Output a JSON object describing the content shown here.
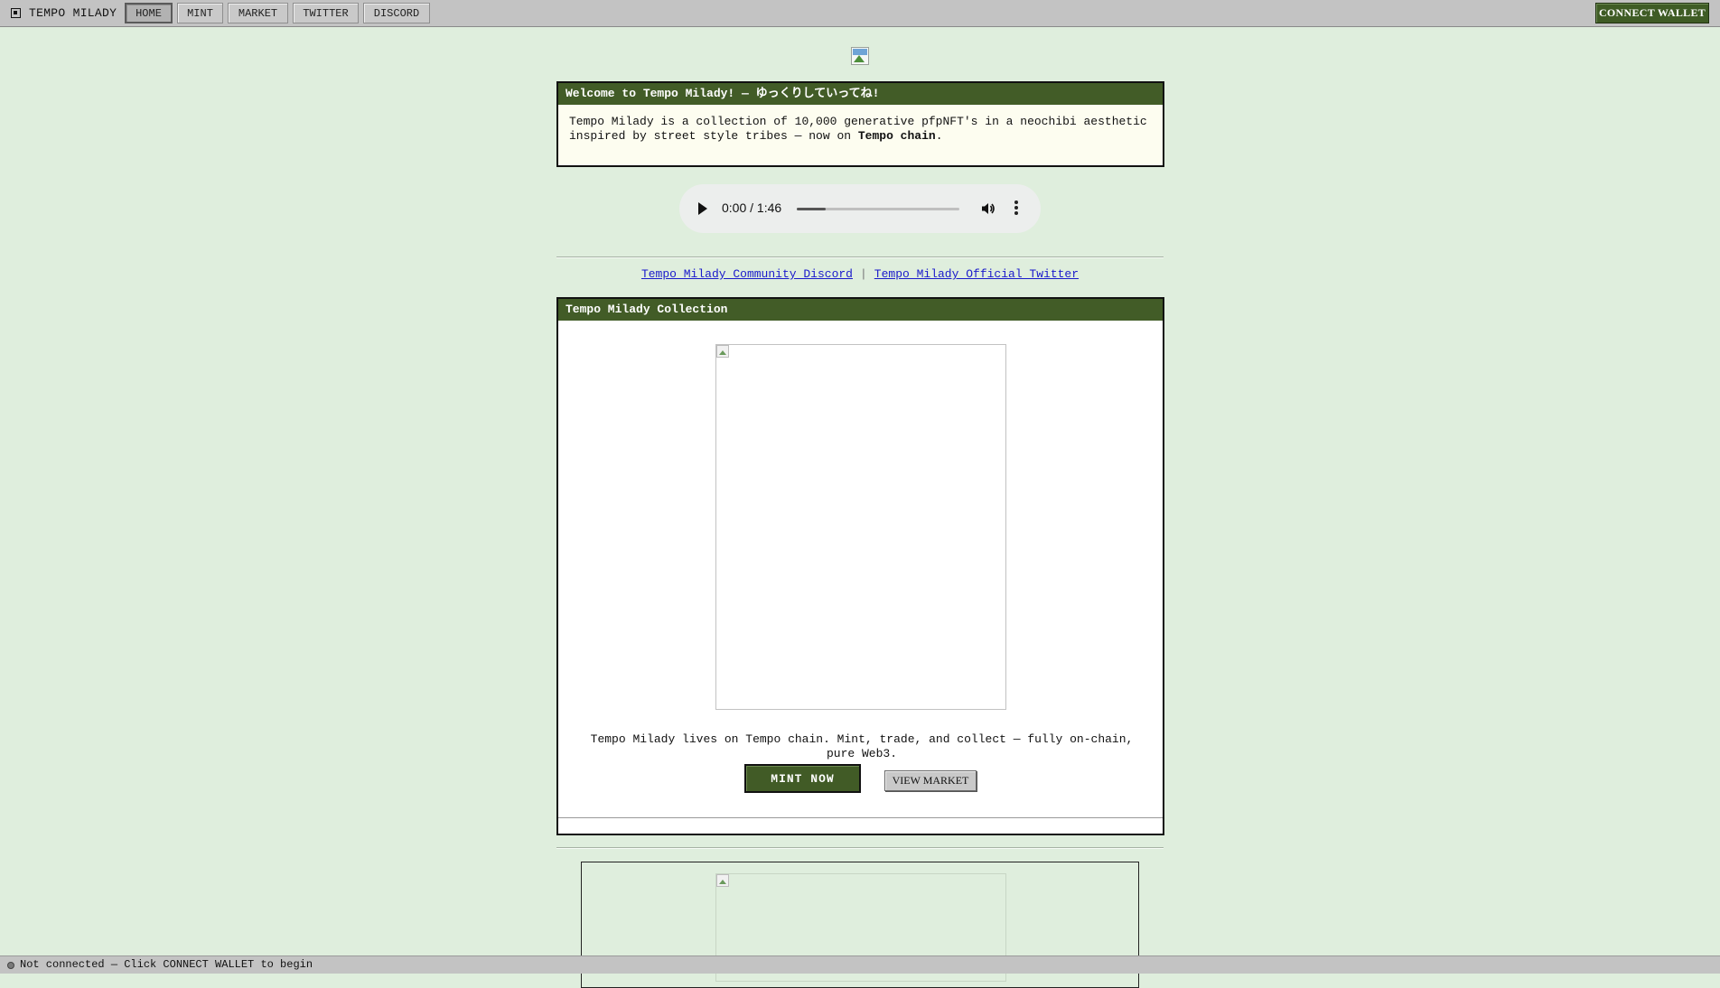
{
  "app": {
    "brand": "TEMPO MILADY",
    "nav": [
      {
        "label": "HOME",
        "active": true
      },
      {
        "label": "MINT",
        "active": false
      },
      {
        "label": "MARKET",
        "active": false
      },
      {
        "label": "TWITTER",
        "active": false
      },
      {
        "label": "DISCORD",
        "active": false
      }
    ],
    "connect_label": "CONNECT WALLET"
  },
  "welcome": {
    "title": "Welcome to Tempo Milady! — ゆっくりしていってね!",
    "body_pre": "Tempo Milady is a collection of 10,000 generative pfpNFT's in a neochibi aesthetic inspired by street style tribes — now on ",
    "body_bold": "Tempo chain",
    "body_post": "."
  },
  "audio": {
    "time": "0:00 / 1:46",
    "buffered_fraction": 0.18
  },
  "links": {
    "discord": "Tempo Milady Community Discord",
    "separator": "|",
    "twitter": "Tempo Milady Official Twitter"
  },
  "collection": {
    "title": "Tempo Milady Collection",
    "description": "Tempo Milady lives on Tempo chain. Mint, trade, and collect — fully on-chain, pure Web3.",
    "mint_label": "MINT NOW",
    "market_label": "VIEW MARKET"
  },
  "status": {
    "text": "Not connected — Click CONNECT WALLET to begin"
  },
  "colors": {
    "page_bg": "#dfeedd",
    "accent": "#425c27",
    "bar": "#c3c3c3"
  }
}
